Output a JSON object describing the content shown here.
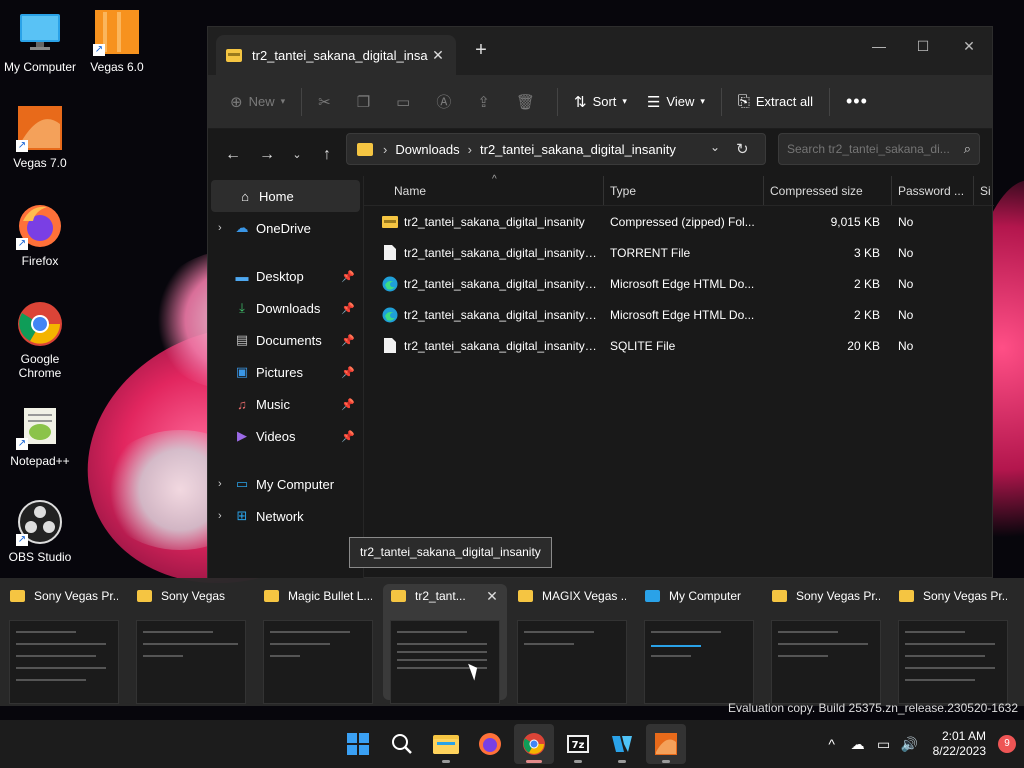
{
  "desktop": {
    "icons": [
      {
        "label": "My Computer"
      },
      {
        "label": "Vegas 6.0"
      },
      {
        "label": "Vegas 7.0"
      },
      {
        "label": "Firefox"
      },
      {
        "label": "Google Chrome"
      },
      {
        "label": "Notepad++"
      },
      {
        "label": "OBS Studio"
      }
    ]
  },
  "explorer": {
    "tab_title": "tr2_tantei_sakana_digital_insa",
    "toolbar": {
      "new": "New",
      "sort": "Sort",
      "view": "View",
      "extract_all": "Extract all"
    },
    "breadcrumb": [
      "Downloads",
      "tr2_tantei_sakana_digital_insanity"
    ],
    "search_placeholder": "Search tr2_tantei_sakana_di...",
    "nav": {
      "home": "Home",
      "onedrive": "OneDrive",
      "desktop": "Desktop",
      "downloads": "Downloads",
      "documents": "Documents",
      "pictures": "Pictures",
      "music": "Music",
      "videos": "Videos",
      "my_computer": "My Computer",
      "network": "Network"
    },
    "columns": {
      "name": "Name",
      "type": "Type",
      "size": "Compressed size",
      "password": "Password ...",
      "extra": "Si"
    },
    "files": [
      {
        "name": "tr2_tantei_sakana_digital_insanity",
        "type": "Compressed (zipped) Fol...",
        "size": "9,015 KB",
        "password": "No"
      },
      {
        "name": "tr2_tantei_sakana_digital_insanity_a...",
        "type": "TORRENT File",
        "size": "3 KB",
        "password": "No"
      },
      {
        "name": "tr2_tantei_sakana_digital_insanity_f...",
        "type": "Microsoft Edge HTML Do...",
        "size": "2 KB",
        "password": "No"
      },
      {
        "name": "tr2_tantei_sakana_digital_insanity_...",
        "type": "Microsoft Edge HTML Do...",
        "size": "2 KB",
        "password": "No"
      },
      {
        "name": "tr2_tantei_sakana_digital_insanity_...",
        "type": "SQLITE File",
        "size": "20 KB",
        "password": "No"
      }
    ],
    "tooltip": "tr2_tantei_sakana_digital_insanity"
  },
  "switcher": {
    "windows": [
      {
        "title": "Sony Vegas Pr..."
      },
      {
        "title": "Sony Vegas"
      },
      {
        "title": "Magic Bullet L..."
      },
      {
        "title": "tr2_tant..."
      },
      {
        "title": "MAGIX Vegas ..."
      },
      {
        "title": "My Computer"
      },
      {
        "title": "Sony Vegas Pr..."
      },
      {
        "title": "Sony Vegas Pr..."
      }
    ]
  },
  "watermark": "Evaluation copy. Build 25375.zn_release.230520-1632",
  "taskbar": {
    "time": "2:01 AM",
    "date": "8/22/2023",
    "notifications": "9"
  }
}
